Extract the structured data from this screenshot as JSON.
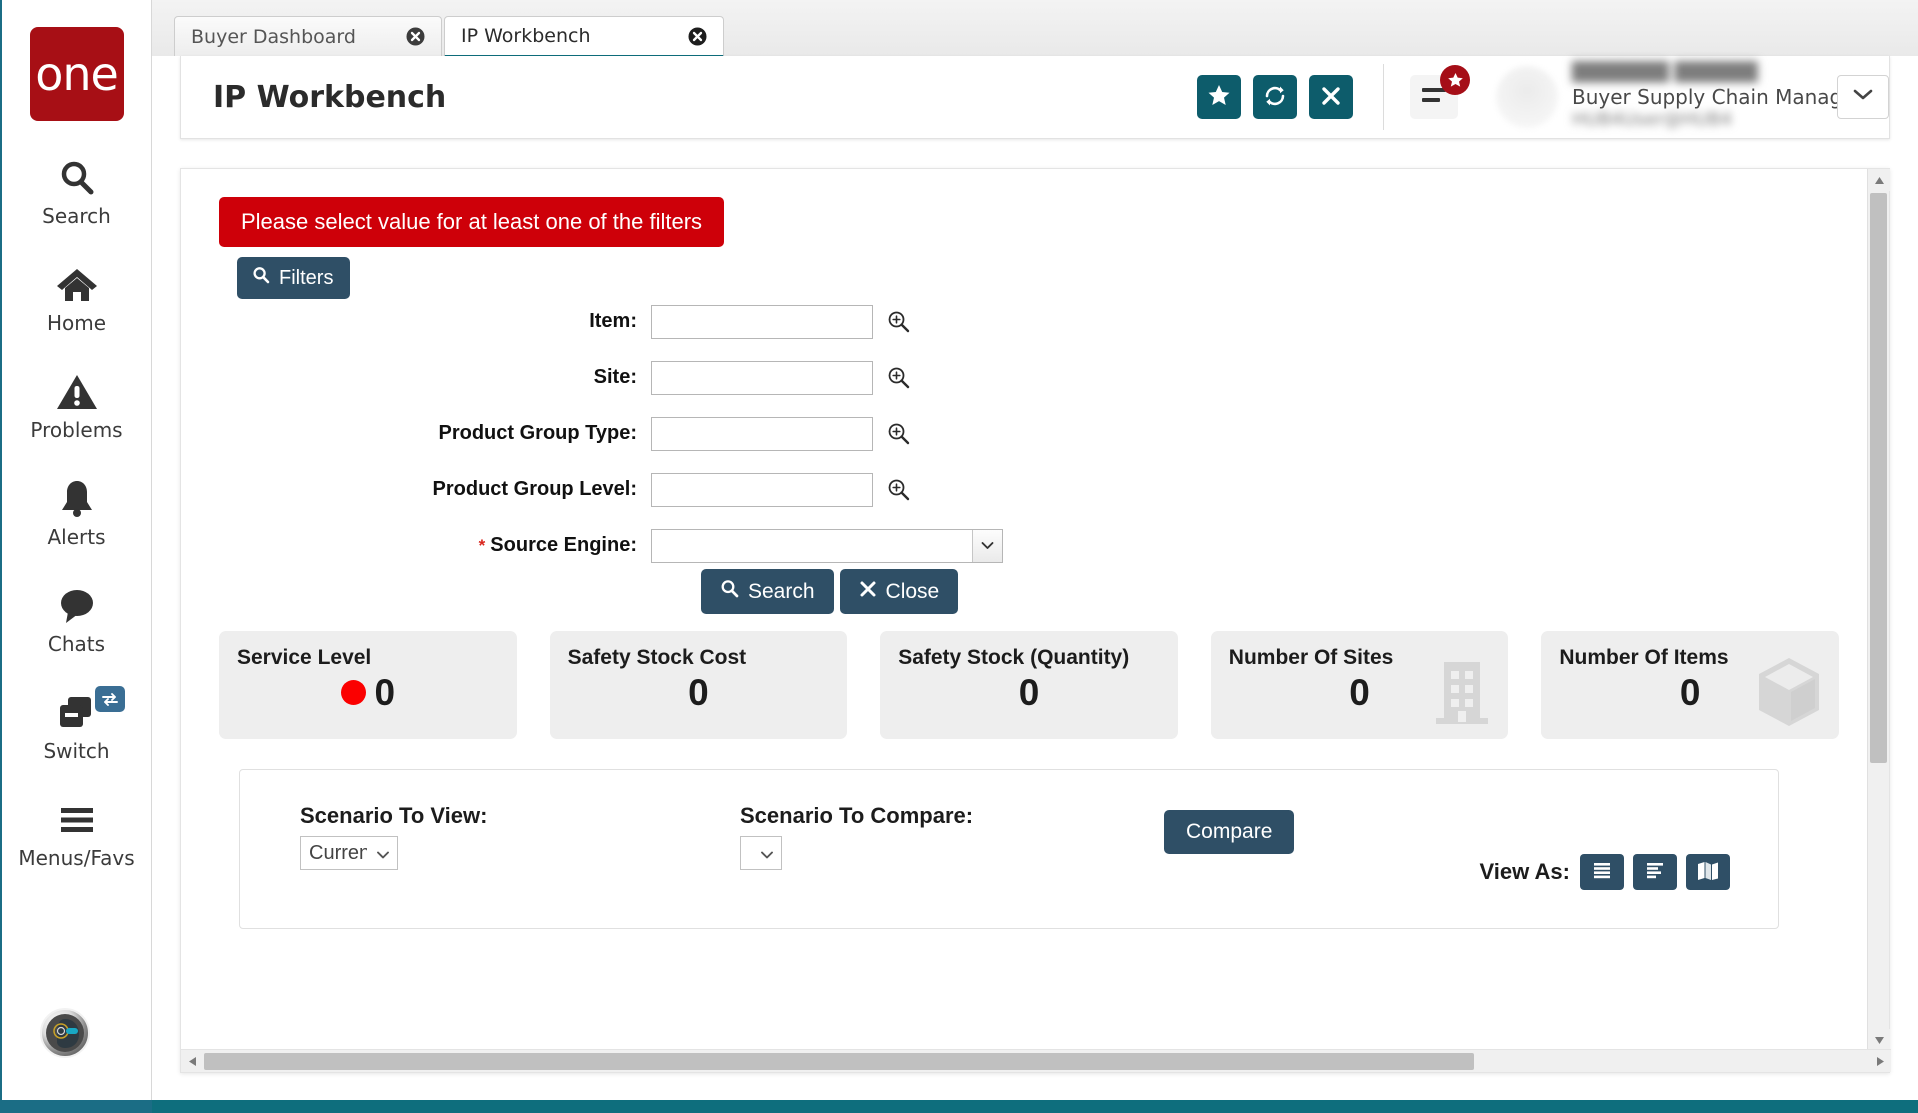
{
  "sidebar": {
    "logo_text": "one",
    "items": [
      {
        "label": "Search",
        "icon": "search-icon"
      },
      {
        "label": "Home",
        "icon": "home-icon"
      },
      {
        "label": "Problems",
        "icon": "warning-triangle-icon"
      },
      {
        "label": "Alerts",
        "icon": "bell-icon"
      },
      {
        "label": "Chats",
        "icon": "chat-bubble-icon"
      },
      {
        "label": "Switch",
        "icon": "switch-windows-icon",
        "badge_icon": "exchange-arrows-icon"
      },
      {
        "label": "Menus/Favs",
        "icon": "hamburger-icon"
      }
    ],
    "assistant_avatar": "robot-head-avatar"
  },
  "tabs": [
    {
      "label": "Buyer Dashboard",
      "active": false,
      "close_icon": "close-circle-icon"
    },
    {
      "label": "IP Workbench",
      "active": true,
      "close_icon": "close-circle-icon"
    }
  ],
  "header": {
    "title": "IP Workbench",
    "actions": [
      {
        "name": "favorite-button",
        "icon": "star-icon"
      },
      {
        "name": "refresh-button",
        "icon": "refresh-icon"
      },
      {
        "name": "close-button",
        "icon": "x-icon"
      }
    ],
    "menu_icon": "hamburger-icon",
    "menu_badge_icon": "star-icon",
    "user": {
      "name_redacted": "███████ ██████",
      "role": "Buyer Supply Chain Manager",
      "email_redacted": "HUB4User@HUB4",
      "caret_icon": "chevron-down-icon"
    }
  },
  "content": {
    "error_message": "Please select value for at least one of the filters",
    "filters_button": "Filters",
    "filters_button_icon": "search-icon",
    "fields": [
      {
        "label": "Item:",
        "value": "",
        "required": false,
        "control": "text",
        "lookup_icon": "magnifier-plus-icon"
      },
      {
        "label": "Site:",
        "value": "",
        "required": false,
        "control": "text",
        "lookup_icon": "magnifier-plus-icon"
      },
      {
        "label": "Product Group Type:",
        "value": "",
        "required": false,
        "control": "text",
        "lookup_icon": "magnifier-plus-icon"
      },
      {
        "label": "Product Group Level:",
        "value": "",
        "required": false,
        "control": "text",
        "lookup_icon": "magnifier-plus-icon"
      },
      {
        "label": "Source Engine:",
        "value": "",
        "required": true,
        "control": "select",
        "options": [
          ""
        ]
      }
    ],
    "required_marker": "*",
    "actions": [
      {
        "label": "Search",
        "icon": "search-icon"
      },
      {
        "label": "Close",
        "icon": "x-icon"
      }
    ],
    "kpis": [
      {
        "title": "Service Level",
        "value": "0",
        "status_color": "#fb0000",
        "has_dot": true,
        "watermark": "none"
      },
      {
        "title": "Safety Stock Cost",
        "value": "0",
        "has_dot": false,
        "watermark": "none"
      },
      {
        "title": "Safety Stock (Quantity)",
        "value": "0",
        "has_dot": false,
        "watermark": "none"
      },
      {
        "title": "Number Of Sites",
        "value": "0",
        "has_dot": false,
        "watermark": "building-icon"
      },
      {
        "title": "Number Of Items",
        "value": "0",
        "has_dot": false,
        "watermark": "box-icon"
      }
    ],
    "scenario": {
      "view_label": "Scenario To View:",
      "view_value": "Current",
      "view_options": [
        "Current"
      ],
      "compare_label": "Scenario To Compare:",
      "compare_value": "",
      "compare_options": [
        ""
      ],
      "compare_button": "Compare",
      "view_as_label": "View As:",
      "view_as_buttons": [
        {
          "name": "view-as-grid-button",
          "icon": "grid-rows-icon"
        },
        {
          "name": "view-as-outline-button",
          "icon": "outline-list-icon"
        },
        {
          "name": "view-as-map-button",
          "icon": "map-icon"
        }
      ]
    }
  },
  "colors": {
    "brand_red": "#a70f15",
    "teal": "#0d5c6b",
    "slate": "#2f4f66",
    "error_red": "#ce0009",
    "status_red": "#fb0000"
  }
}
